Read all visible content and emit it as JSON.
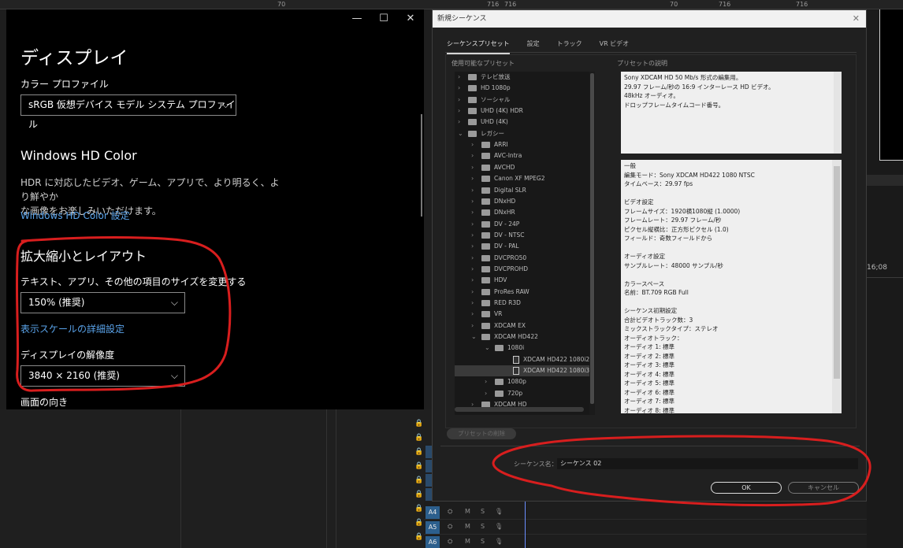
{
  "background": {
    "ruler_numbers": [
      "70",
      "716",
      "716",
      "70",
      "716",
      "716"
    ],
    "timecode": "16;08",
    "audio_tracks": [
      "A4",
      "A5",
      "A6"
    ],
    "track_controls": [
      "M",
      "S"
    ]
  },
  "windows_display": {
    "controls": {
      "minimize": "—",
      "maximize": "☐",
      "close": "✕"
    },
    "title": "ディスプレイ",
    "color_profile": {
      "label": "カラー プロファイル",
      "value": "sRGB 仮想デバイス モデル システム プロファイル"
    },
    "hd_color": {
      "heading": "Windows HD Color",
      "desc_line1": "HDR に対応したビデオ、ゲーム、アプリで、より明るく、より鮮やか",
      "desc_line2": "な画像をお楽しみいただけます。",
      "link": "Windows HD Color 設定"
    },
    "scale_layout": {
      "heading": "拡大縮小とレイアウト",
      "size_label": "テキスト、アプリ、その他の項目のサイズを変更する",
      "size_value": "150% (推奨)",
      "advanced_link": "表示スケールの詳細設定",
      "resolution_label": "ディスプレイの解像度",
      "resolution_value": "3840 × 2160 (推奨)",
      "orientation_label": "画面の向き"
    }
  },
  "sequence_dialog": {
    "title": "新規シーケンス",
    "close": "✕",
    "tabs": [
      "シーケンスプリセット",
      "設定",
      "トラック",
      "VR ビデオ"
    ],
    "available_presets_label": "使用可能なプリセット",
    "preset_description_label": "プリセットの説明",
    "tree": [
      {
        "label": "テレビ放送",
        "level": 0,
        "expanded": false,
        "type": "folder"
      },
      {
        "label": "HD 1080p",
        "level": 0,
        "expanded": false,
        "type": "folder"
      },
      {
        "label": "ソーシャル",
        "level": 0,
        "expanded": false,
        "type": "folder"
      },
      {
        "label": "UHD (4K) HDR",
        "level": 0,
        "expanded": false,
        "type": "folder"
      },
      {
        "label": "UHD (4K)",
        "level": 0,
        "expanded": false,
        "type": "folder"
      },
      {
        "label": "レガシー",
        "level": 0,
        "expanded": true,
        "type": "folder"
      },
      {
        "label": "ARRI",
        "level": 1,
        "expanded": false,
        "type": "folder"
      },
      {
        "label": "AVC-Intra",
        "level": 1,
        "expanded": false,
        "type": "folder"
      },
      {
        "label": "AVCHD",
        "level": 1,
        "expanded": false,
        "type": "folder"
      },
      {
        "label": "Canon XF MPEG2",
        "level": 1,
        "expanded": false,
        "type": "folder"
      },
      {
        "label": "Digital SLR",
        "level": 1,
        "expanded": false,
        "type": "folder"
      },
      {
        "label": "DNxHD",
        "level": 1,
        "expanded": false,
        "type": "folder"
      },
      {
        "label": "DNxHR",
        "level": 1,
        "expanded": false,
        "type": "folder"
      },
      {
        "label": "DV - 24P",
        "level": 1,
        "expanded": false,
        "type": "folder"
      },
      {
        "label": "DV - NTSC",
        "level": 1,
        "expanded": false,
        "type": "folder"
      },
      {
        "label": "DV - PAL",
        "level": 1,
        "expanded": false,
        "type": "folder"
      },
      {
        "label": "DVCPRO50",
        "level": 1,
        "expanded": false,
        "type": "folder"
      },
      {
        "label": "DVCPROHD",
        "level": 1,
        "expanded": false,
        "type": "folder"
      },
      {
        "label": "HDV",
        "level": 1,
        "expanded": false,
        "type": "folder"
      },
      {
        "label": "ProRes RAW",
        "level": 1,
        "expanded": false,
        "type": "folder"
      },
      {
        "label": "RED R3D",
        "level": 1,
        "expanded": false,
        "type": "folder"
      },
      {
        "label": "VR",
        "level": 1,
        "expanded": false,
        "type": "folder"
      },
      {
        "label": "XDCAM EX",
        "level": 1,
        "expanded": false,
        "type": "folder"
      },
      {
        "label": "XDCAM HD422",
        "level": 1,
        "expanded": true,
        "type": "folder"
      },
      {
        "label": "1080i",
        "level": 2,
        "expanded": true,
        "type": "folder"
      },
      {
        "label": "XDCAM HD422 1080i2...",
        "level": 3,
        "type": "file"
      },
      {
        "label": "XDCAM HD422 1080i3...",
        "level": 3,
        "type": "file",
        "selected": true
      },
      {
        "label": "1080p",
        "level": 2,
        "expanded": false,
        "type": "folder"
      },
      {
        "label": "720p",
        "level": 2,
        "expanded": false,
        "type": "folder"
      },
      {
        "label": "XDCAM HD",
        "level": 1,
        "expanded": false,
        "type": "folder"
      }
    ],
    "description_lines": [
      "Sony XDCAM HD 50 Mb/s 形式の編集用。",
      "29.97 フレーム/秒の 16:9 インターレース HD ビデオ。",
      "48kHz オーディオ。",
      "ドロップフレームタイムコード番号。"
    ],
    "info_lines": [
      "一般",
      " 編集モード：Sony XDCAM HD422 1080 NTSC",
      " タイムベース：29.97 fps",
      "",
      "ビデオ設定",
      " フレームサイズ：1920横1080縦 (1.0000)",
      " フレームレート：29.97 フレーム/秒",
      " ピクセル縦横比：正方形ピクセル (1.0)",
      " フィールド：奇数フィールドから",
      "",
      "オーディオ設定",
      " サンプルレート：48000 サンプル/秒",
      "",
      "カラースペース",
      " 名前：BT.709 RGB Full",
      "",
      "シーケンス初期設定",
      " 合計ビデオトラック数：3",
      " ミックストラックタイプ：ステレオ",
      " オーディオトラック：",
      " オーディオ 1: 標準",
      " オーディオ 2: 標準",
      " オーディオ 3: 標準",
      " オーディオ 4: 標準",
      " オーディオ 5: 標準",
      " オーディオ 6: 標準",
      " オーディオ 7: 標準",
      " オーディオ 8: 標準"
    ],
    "delete_preset_label": "プリセットの削除",
    "sequence_name_label": "シーケンス名：",
    "sequence_name_value": "シーケンス 02",
    "ok_label": "OK",
    "cancel_label": "キャンセル"
  },
  "colors": {
    "link": "#5aa3ea",
    "annotation_red": "#d81e1e",
    "track_blue": "#2c5f8d"
  }
}
